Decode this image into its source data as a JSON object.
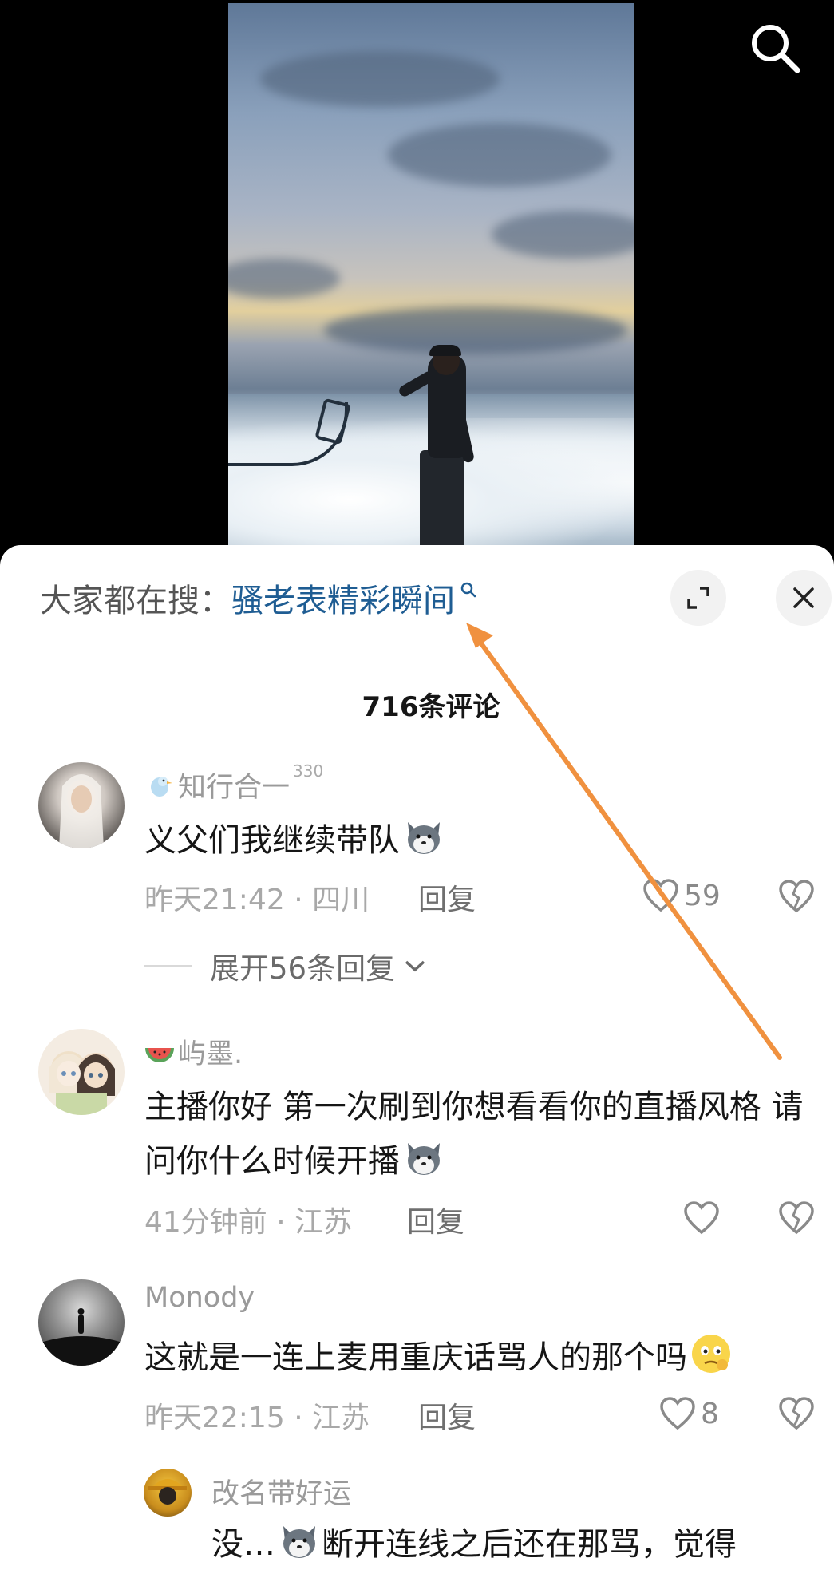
{
  "video": {
    "search_icon": "search-icon"
  },
  "hot_search": {
    "prefix": "大家都在搜：",
    "term": "骚老表精彩瞬间",
    "term_color": "#1f5d93"
  },
  "panel": {
    "comment_count": "716条评论"
  },
  "comments": [
    {
      "user": "知行合一",
      "user_sup": "330",
      "badge": "bird-icon",
      "text": "义父们我继续带队",
      "emoji": "wolf-emoji",
      "time": "昨天21:42",
      "location": "四川",
      "reply_label": "回复",
      "likes": "59",
      "expand_replies": "展开56条回复"
    },
    {
      "user": "屿墨.",
      "badge": "watermelon-icon",
      "text": "主播你好 第一次刷到你想看看你的直播风格 请问你什么时候开播",
      "emoji": "wolf-emoji",
      "time": "41分钟前",
      "location": "江苏",
      "reply_label": "回复"
    },
    {
      "user": "Monody",
      "text": "这就是一连上麦用重庆话骂人的那个吗",
      "emoji": "thinking-emoji",
      "time": "昨天22:15",
      "location": "江苏",
      "reply_label": "回复",
      "likes": "8"
    }
  ],
  "reply": {
    "user": "改名带好运",
    "text_before": "没…",
    "text_after": "断开连线之后还在那骂，觉得"
  },
  "annotation": {
    "color": "#f0913f"
  },
  "colors": {
    "accent_blue": "#1f5d93",
    "text_main": "#161616",
    "text_muted": "#a8a8a8"
  }
}
